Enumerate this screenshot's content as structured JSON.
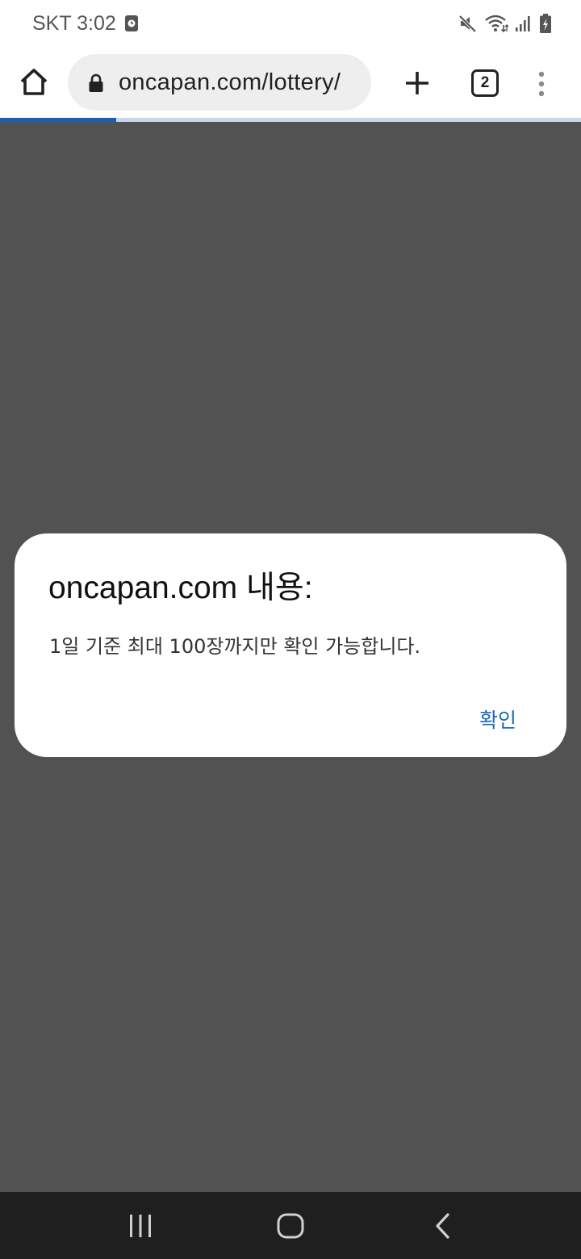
{
  "status_bar": {
    "carrier_time": "SKT 3:02",
    "icons": [
      "alarm-icon",
      "mute-icon",
      "wifi-icon",
      "signal-icon",
      "battery-icon"
    ]
  },
  "browser": {
    "url": "oncapan.com/lottery/",
    "tab_count": "2",
    "page_load_progress": 0.2,
    "icons": [
      "home-icon",
      "lock-icon",
      "plus-icon",
      "more-vert-icon"
    ]
  },
  "dialog": {
    "title": "oncapan.com 내용:",
    "message": "1일 기준 최대 100장까지만 확인 가능합니다.",
    "ok_label": "확인"
  },
  "nav_bar": {
    "icons": [
      "recent-apps-icon",
      "home-button-icon",
      "back-icon"
    ]
  },
  "colors": {
    "page_overlay": "#525252",
    "progress": "#1a5fb4",
    "dialog_button": "#1a6ab8",
    "nav_bar": "#1f1f1f"
  }
}
